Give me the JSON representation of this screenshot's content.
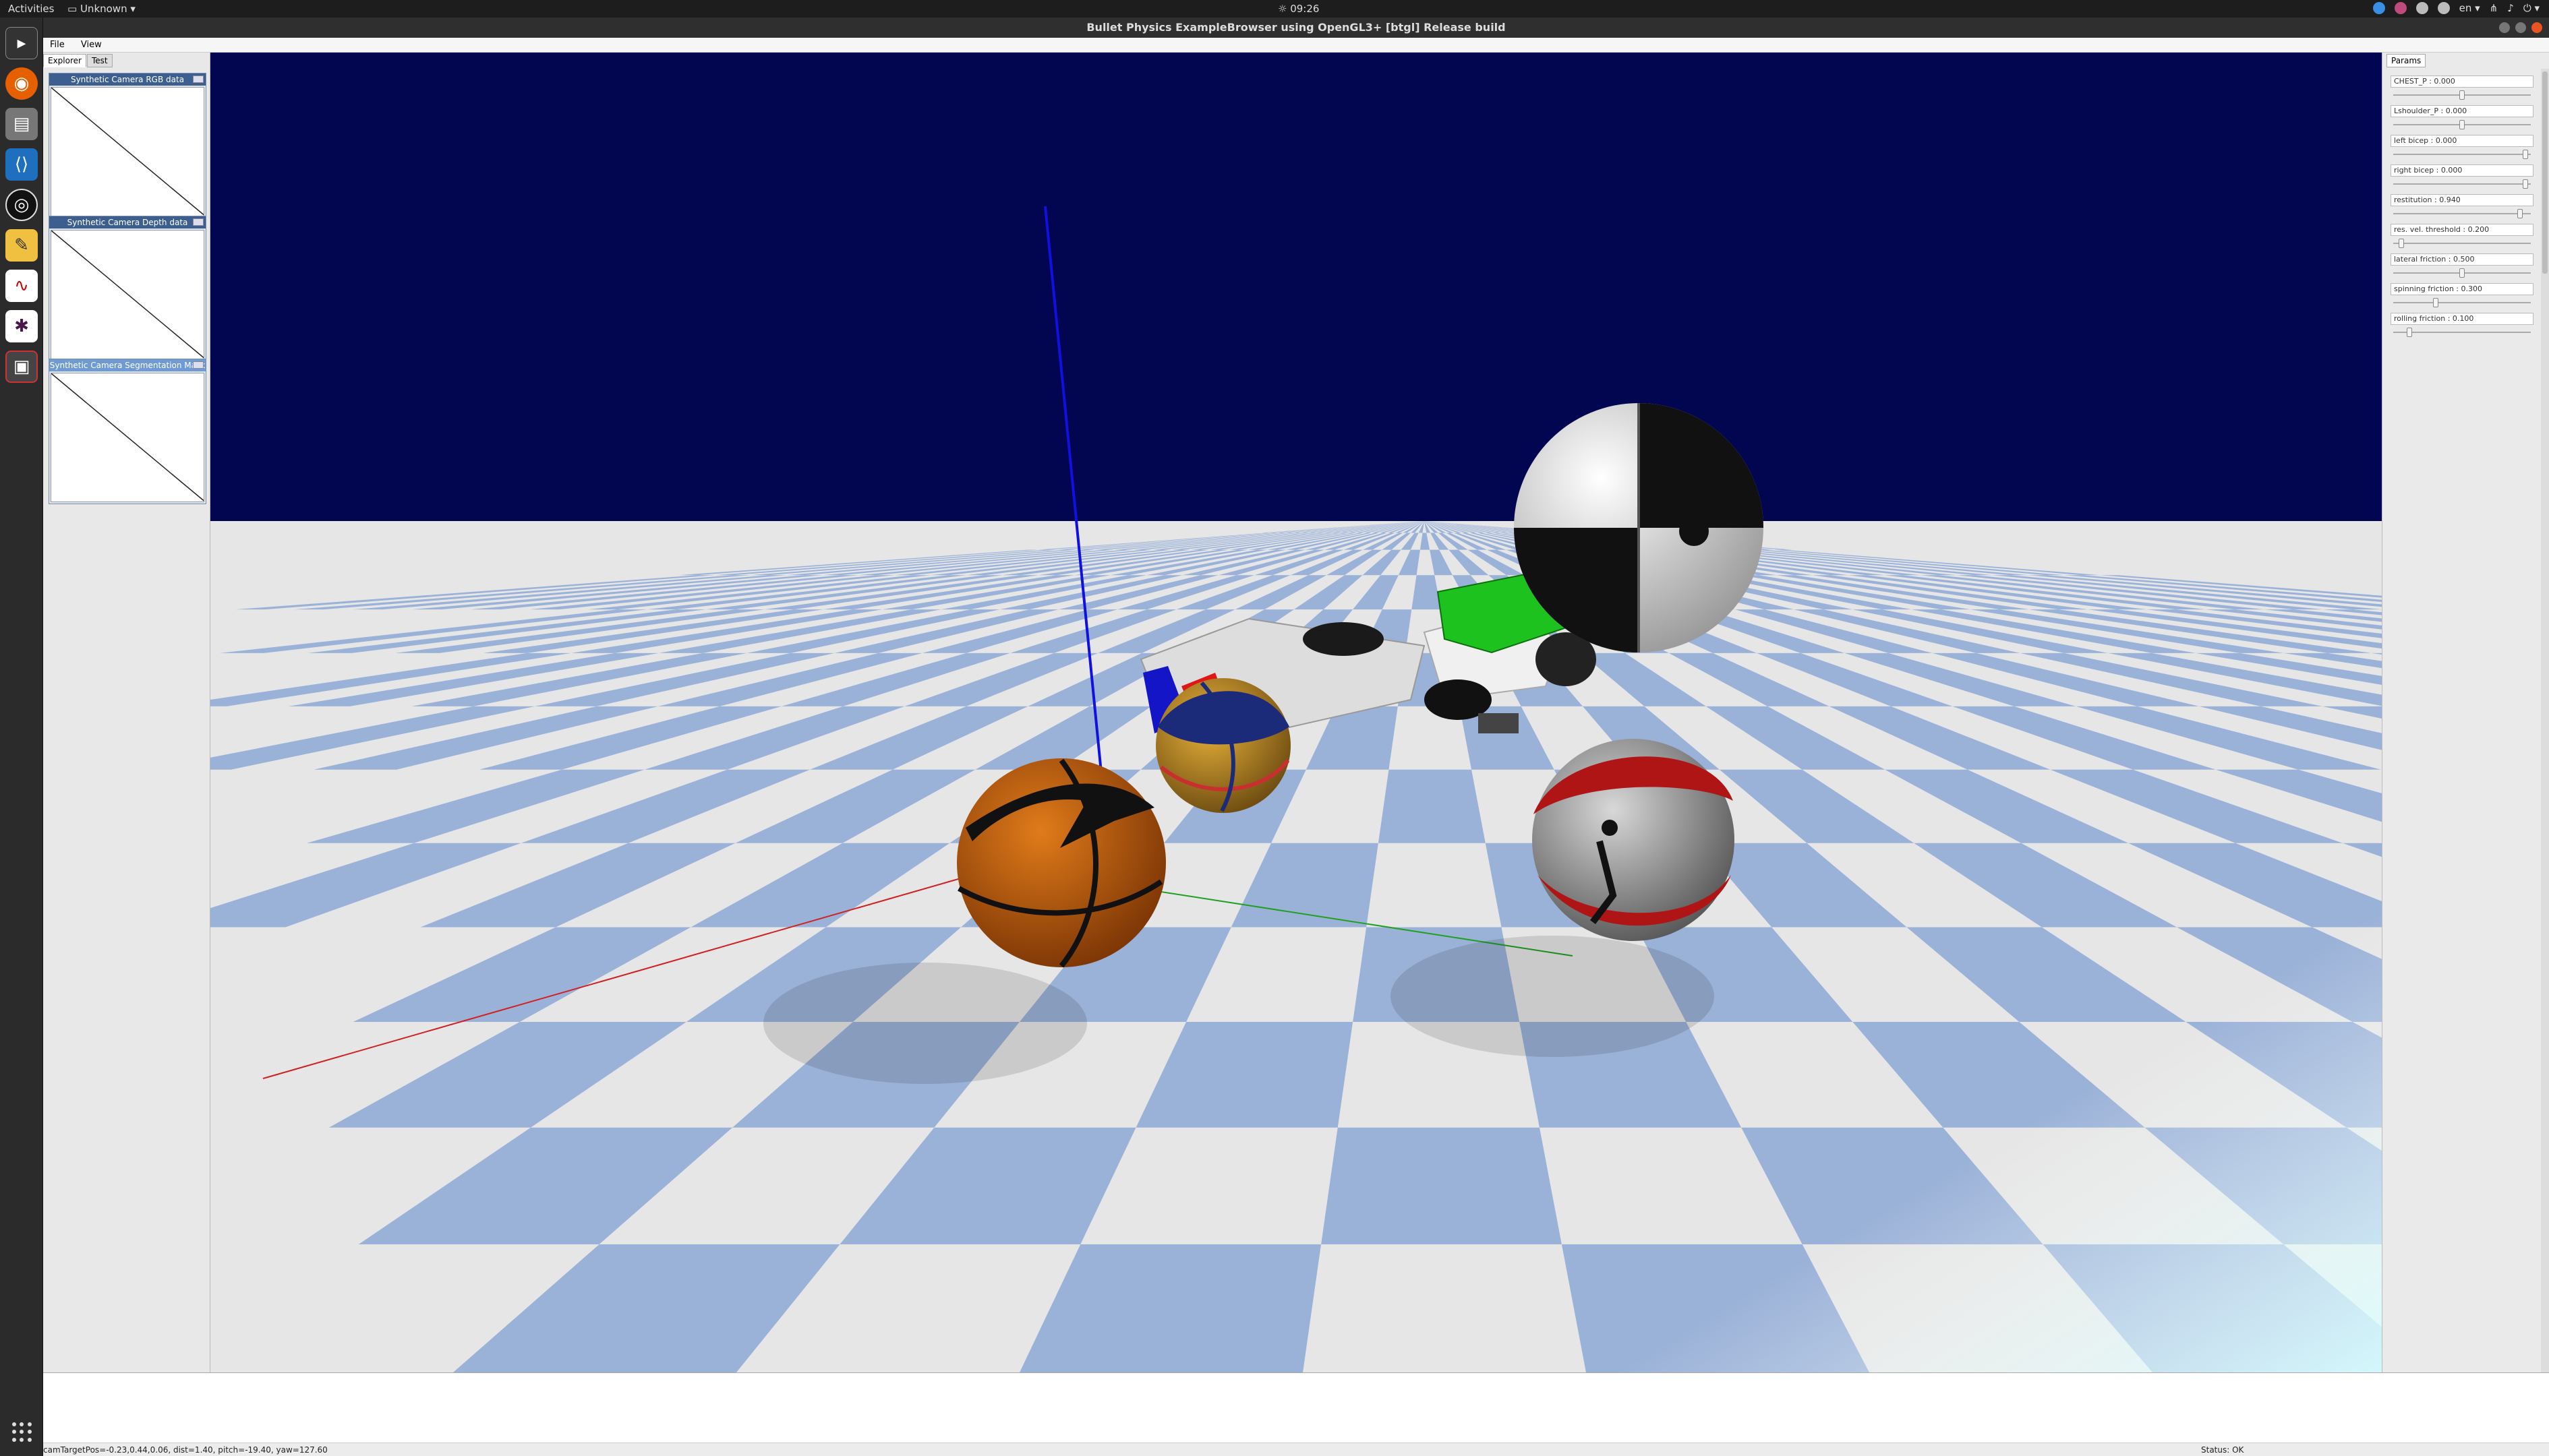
{
  "topbar": {
    "activities": "Activities",
    "app_menu": "Unknown",
    "clock": "09:26",
    "language": "en"
  },
  "window": {
    "title": "Bullet Physics ExampleBrowser using OpenGL3+ [btgl] Release build"
  },
  "menu": {
    "file": "File",
    "view": "View"
  },
  "explorer": {
    "tabs": [
      "Explorer",
      "Test"
    ],
    "panels": [
      "Synthetic Camera RGB data",
      "Synthetic Camera Depth data",
      "Synthetic Camera Segmentation Mask"
    ]
  },
  "params": {
    "tab": "Params",
    "sliders": [
      {
        "label": "CHEST_P : 0.000",
        "level": 0.5
      },
      {
        "label": "Lshoulder_P : 0.000",
        "level": 0.5
      },
      {
        "label": "left bicep : 0.000",
        "level": 0.98
      },
      {
        "label": "right bicep : 0.000",
        "level": 0.98
      },
      {
        "label": "restitution : 0.940",
        "level": 0.94
      },
      {
        "label": "res. vel. threshold : 0.200",
        "level": 0.04
      },
      {
        "label": "lateral friction : 0.500",
        "level": 0.5
      },
      {
        "label": "spinning friction : 0.300",
        "level": 0.3
      },
      {
        "label": "rolling friction : 0.100",
        "level": 0.1
      }
    ]
  },
  "statusbar": {
    "camera": "camTargetPos=-0.23,0.44,0.06, dist=1.40, pitch=-19.40, yaw=127.60",
    "status": "Status: OK"
  },
  "colors": {
    "sky": "#020550",
    "floor_light": "#e6e6e6",
    "floor_tile": "#9bb2d8",
    "accent": "#e95420"
  }
}
